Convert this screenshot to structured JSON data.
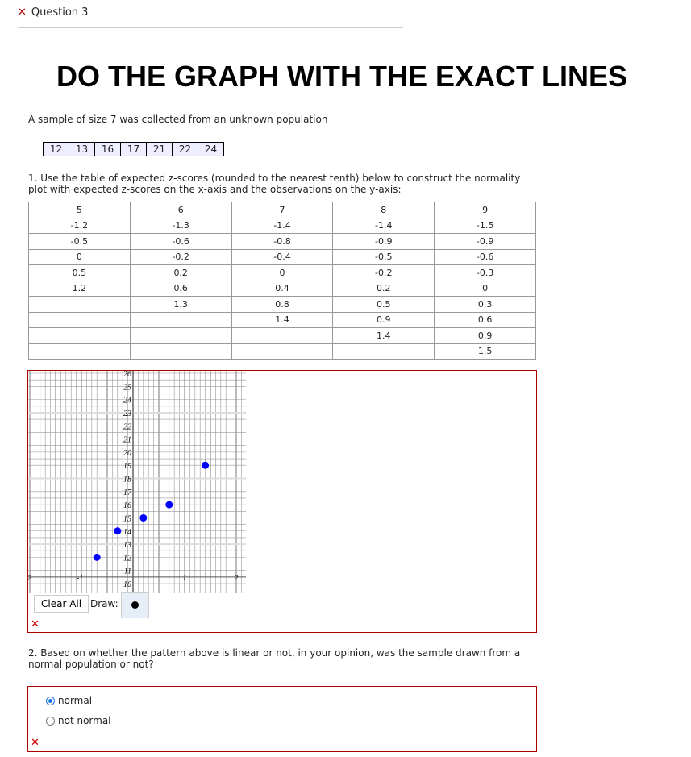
{
  "header": {
    "status_icon": "x-mark-icon",
    "title": "Question 3"
  },
  "heading": "DO THE GRAPH WITH THE EXACT LINES",
  "intro": "A sample of size 7 was collected from an unknown population",
  "sample": [
    "12",
    "13",
    "16",
    "17",
    "21",
    "22",
    "24"
  ],
  "q1": "1. Use the table of expected z-scores (rounded to the nearest tenth) below to construct the normality plot with expected z-scores on the x-axis and the observations on the y-axis:",
  "ztable": {
    "headers": [
      "5",
      "6",
      "7",
      "8",
      "9"
    ],
    "rows": [
      [
        "-1.2",
        "-1.3",
        "-1.4",
        "-1.4",
        "-1.5"
      ],
      [
        "-0.5",
        "-0.6",
        "-0.8",
        "-0.9",
        "-0.9"
      ],
      [
        "0",
        "-0.2",
        "-0.4",
        "-0.5",
        "-0.6"
      ],
      [
        "0.5",
        "0.2",
        "0",
        "-0.2",
        "-0.3"
      ],
      [
        "1.2",
        "0.6",
        "0.4",
        "0.2",
        "0"
      ],
      [
        "",
        "1.3",
        "0.8",
        "0.5",
        "0.3"
      ],
      [
        "",
        "",
        "1.4",
        "0.9",
        "0.6"
      ],
      [
        "",
        "",
        "",
        "1.4",
        "0.9"
      ],
      [
        "",
        "",
        "",
        "",
        "1.5"
      ]
    ]
  },
  "chart_data": {
    "type": "scatter",
    "xlim": [
      -2,
      2
    ],
    "ylim": [
      10,
      26
    ],
    "grid": true,
    "x_ticks": [
      "-2",
      "-1",
      "1",
      "2"
    ],
    "y_ticks": [
      "10",
      "11",
      "12",
      "13",
      "14",
      "15",
      "16",
      "17",
      "18",
      "19",
      "20",
      "21",
      "22",
      "23",
      "24",
      "25",
      "26"
    ],
    "points": [
      {
        "x": -0.7,
        "y": 12
      },
      {
        "x": -0.3,
        "y": 14
      },
      {
        "x": 0.2,
        "y": 15
      },
      {
        "x": 0.7,
        "y": 16
      },
      {
        "x": 1.4,
        "y": 19
      }
    ],
    "point_color": "#0000ff"
  },
  "graph_controls": {
    "clear_label": "Clear All",
    "draw_label": "Draw:",
    "draw_tool_icon": "point-tool-icon"
  },
  "q2": "2. Based on whether the pattern above is linear or not, in your opinion, was the sample drawn from a normal population or not?",
  "options": [
    {
      "label": "normal",
      "selected": true
    },
    {
      "label": "not normal",
      "selected": false
    }
  ],
  "error_icon": "✕"
}
